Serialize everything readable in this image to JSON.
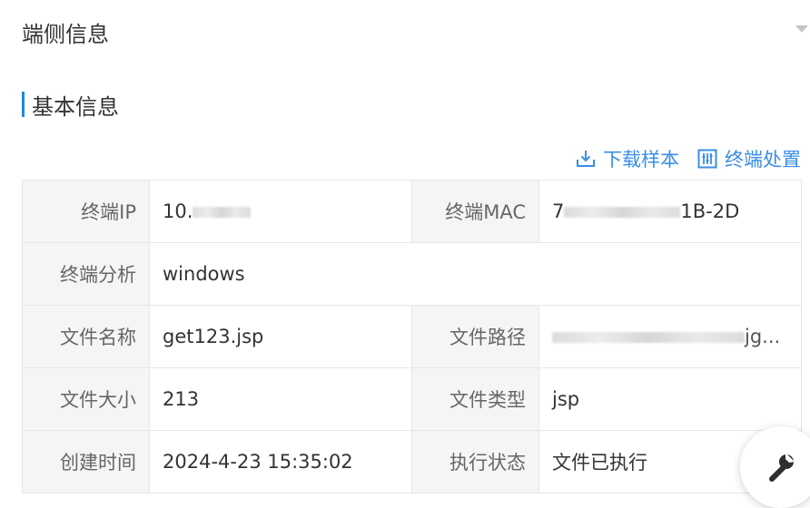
{
  "panel": {
    "title": "端侧信息"
  },
  "section": {
    "title": "基本信息"
  },
  "actions": {
    "download_sample": "下载样本",
    "terminal_handle": "终端处置"
  },
  "fields": {
    "terminal_ip": {
      "label": "终端IP",
      "value": "10."
    },
    "terminal_mac": {
      "label": "终端MAC",
      "value_prefix": "7",
      "value_suffix": "1B-2D"
    },
    "terminal_analysis": {
      "label": "终端分析",
      "value": "windows"
    },
    "file_name": {
      "label": "文件名称",
      "value": "get123.jsp"
    },
    "file_path": {
      "label": "文件路径",
      "value_suffix": "jg..."
    },
    "file_size": {
      "label": "文件大小",
      "value": "213"
    },
    "file_type": {
      "label": "文件类型",
      "value": "jsp"
    },
    "created_time": {
      "label": "创建时间",
      "value": "2024-4-23 15:35:02"
    },
    "exec_status": {
      "label": "执行状态",
      "value": "文件已执行"
    }
  },
  "colors": {
    "accent": "#1e88e5",
    "link": "#3a8ee6",
    "label_bg": "#f5f5f5",
    "border": "#e6e6e6"
  },
  "icons": [
    "download-icon",
    "terminal-handle-icon",
    "chevron-down-icon",
    "wrench-icon"
  ]
}
